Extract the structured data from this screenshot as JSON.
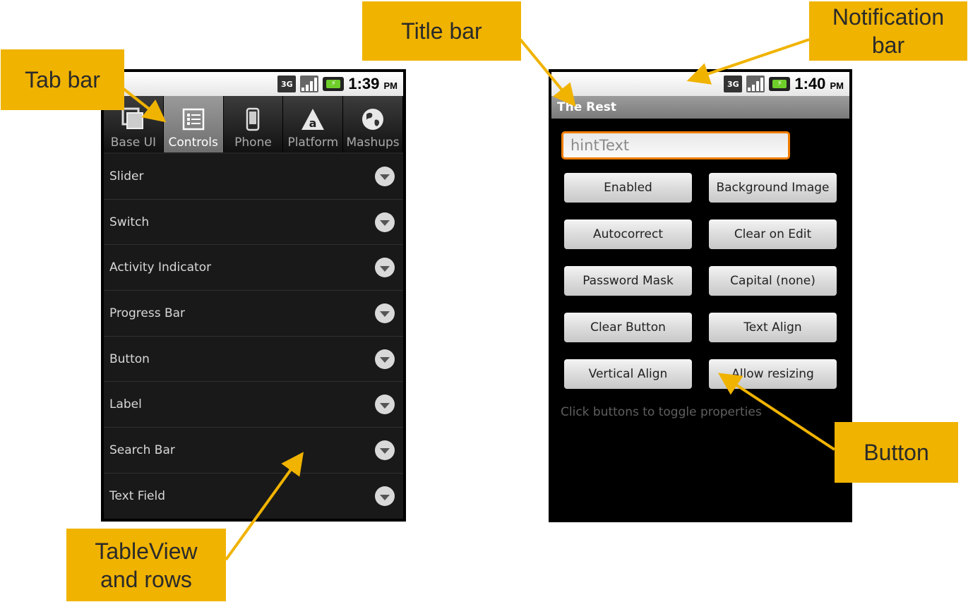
{
  "callouts": {
    "tab_bar": "Tab bar",
    "title_bar": "Title bar",
    "notification_bar_line1": "Notification",
    "notification_bar_line2": "bar",
    "tableview_line1": "TableView",
    "tableview_line2": "and rows",
    "button": "Button",
    "color": "#f0b300"
  },
  "left_phone": {
    "status": {
      "network": "3G",
      "time": "1:39",
      "ampm": "PM"
    },
    "tabs": [
      {
        "label": "Base UI",
        "icon": "windows-icon",
        "active": false
      },
      {
        "label": "Controls",
        "icon": "list-icon",
        "active": true
      },
      {
        "label": "Phone",
        "icon": "phone-icon",
        "active": false
      },
      {
        "label": "Platform",
        "icon": "appcelerator-icon",
        "active": false
      },
      {
        "label": "Mashups",
        "icon": "globe-icon",
        "active": false
      }
    ],
    "rows": [
      "Slider",
      "Switch",
      "Activity Indicator",
      "Progress Bar",
      "Button",
      "Label",
      "Search Bar",
      "Text Field"
    ]
  },
  "right_phone": {
    "status": {
      "network": "3G",
      "time": "1:40",
      "ampm": "PM"
    },
    "title": "The Rest",
    "text_field": {
      "placeholder": "hintText",
      "value": ""
    },
    "buttons": [
      "Enabled",
      "Background Image",
      "Autocorrect",
      "Clear on Edit",
      "Password Mask",
      "Capital (none)",
      "Clear Button",
      "Text Align",
      "Vertical Align",
      "Allow resizing"
    ],
    "hint_label": "Click buttons to toggle properties"
  },
  "colors": {
    "focus_border": "#f07d00",
    "active_tab": "#8a8a8a",
    "row_background": "#191919"
  }
}
